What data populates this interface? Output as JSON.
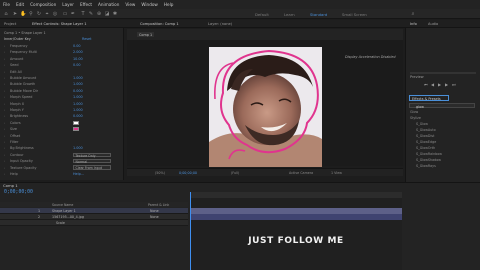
{
  "menubar": [
    "File",
    "Edit",
    "Composition",
    "Layer",
    "Effect",
    "Animation",
    "View",
    "Window",
    "Help"
  ],
  "workspaces": [
    "Default",
    "Learn",
    "Standard",
    "Small Screen"
  ],
  "left_panel": {
    "tabs": [
      "Project",
      "Effect Controls: Shape Layer 1"
    ],
    "breadcrumb": "Comp 1 • Shape Layer 1",
    "effect_name": "Inner/Outer Key",
    "reset_label": "Reset",
    "rows": [
      {
        "label": "Frequency",
        "value": "0.00"
      },
      {
        "label": "Frequency Multi",
        "value": "2.000"
      },
      {
        "label": "Amount",
        "value": "10.00"
      },
      {
        "label": "Seed",
        "value": "0.00"
      },
      {
        "label": "Edit All",
        "value": ""
      },
      {
        "label": "Bubble Amount",
        "value": "1.000"
      },
      {
        "label": "Bubble Growth",
        "value": "1.000"
      },
      {
        "label": "Bubble Move Dir",
        "value": "0.000"
      },
      {
        "label": "Morph Speed",
        "value": "1.000"
      },
      {
        "label": "Morph X",
        "value": "1.000"
      },
      {
        "label": "Morph Y",
        "value": "1.000"
      },
      {
        "label": "Brightness",
        "value": "0.000"
      },
      {
        "label": "Colors",
        "value": ""
      },
      {
        "label": "Size",
        "value": ""
      },
      {
        "label": "Offset",
        "value": ""
      },
      {
        "label": "Filter",
        "value": ""
      },
      {
        "label": "Bg Brightness",
        "value": "1.000"
      },
      {
        "label": "Contour",
        "value": "Texture Only"
      },
      {
        "label": "Input Opacity",
        "value": "Normal"
      },
      {
        "label": "Texture Opacity",
        "value": "Clear From Input"
      },
      {
        "label": "Help",
        "value": "Help..."
      }
    ]
  },
  "viewer": {
    "tabs": [
      "Composition: Comp 1",
      "Layer: (none)"
    ],
    "comp_tab": "Comp 1",
    "accel_notice": "Display Acceleration Disabled",
    "zoom": "(50%)",
    "timecode": "0;00;00;00",
    "quality": "(Full)",
    "camera": "Active Camera",
    "view": "1 View"
  },
  "right_panel": {
    "tabs": [
      "Info",
      "Audio"
    ],
    "preview_label": "Preview",
    "effects_label": "Effects & Presets",
    "search_value": "glow",
    "items": [
      "Glow",
      "Stylize",
      "S_Glow",
      "S_GlowAuto",
      "S_GlowDist",
      "S_GlowEdge",
      "S_GlowOrth",
      "S_GlowRainbow",
      "S_GlowShadow",
      "S_GlowRays"
    ],
    "lower_tabs": [
      "Paragraph",
      "Align"
    ],
    "align_layers_to": "Align Layers to:",
    "distribute_label": "Distribute Layers:"
  },
  "timeline": {
    "tab": "Comp 1",
    "time": "0;00;00;00",
    "columns": [
      "Source Name",
      "Parent & Link"
    ],
    "layers": [
      {
        "num": "1",
        "name": "Shape Layer 1",
        "parent": "None"
      },
      {
        "num": "2",
        "name": "1567195...00_4.jpg",
        "parent": "None"
      },
      {
        "num": "",
        "name": "Scale",
        "parent": ""
      }
    ]
  },
  "caption": "JUST FOLLOW ME",
  "colors": {
    "accent": "#4a8fd8",
    "stroke": "#e0348e",
    "timeline_bar": "#5d6088"
  }
}
